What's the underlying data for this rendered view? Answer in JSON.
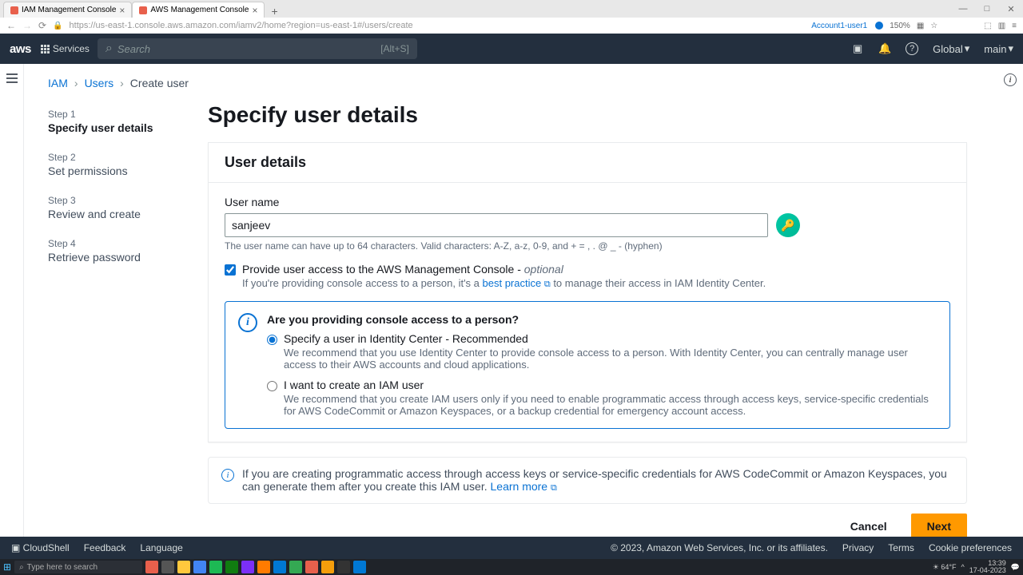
{
  "browser": {
    "tabs": [
      {
        "label": "IAM Management Console",
        "favicon": "#e8604c"
      },
      {
        "label": "AWS Management Console",
        "favicon": "#e8604c"
      }
    ],
    "url": "https://us-east-1.console.aws.amazon.com/iamv2/home?region=us-east-1#/users/create",
    "account_label": "Account1-user1",
    "zoom": "150%"
  },
  "aws_header": {
    "services": "Services",
    "search_placeholder": "Search",
    "search_hint": "[Alt+S]",
    "region": "Global",
    "user": "main"
  },
  "breadcrumb": {
    "root": "IAM",
    "mid": "Users",
    "leaf": "Create user"
  },
  "steps": [
    {
      "num": "Step 1",
      "title": "Specify user details"
    },
    {
      "num": "Step 2",
      "title": "Set permissions"
    },
    {
      "num": "Step 3",
      "title": "Review and create"
    },
    {
      "num": "Step 4",
      "title": "Retrieve password"
    }
  ],
  "page_title": "Specify user details",
  "panel_title": "User details",
  "username": {
    "label": "User name",
    "value": "sanjeev",
    "hint": "The user name can have up to 64 characters. Valid characters: A-Z, a-z, 0-9, and + = , . @ _ - (hyphen)"
  },
  "console_access": {
    "label_pre": "Provide user access to the AWS Management Console - ",
    "label_opt": "optional",
    "sub_pre": "If you're providing console access to a person, it's a ",
    "sub_link": "best practice",
    "sub_post": " to manage their access in IAM Identity Center."
  },
  "person_box": {
    "question": "Are you providing console access to a person?",
    "opt1_label": "Specify a user in Identity Center - Recommended",
    "opt1_sub": "We recommend that you use Identity Center to provide console access to a person. With Identity Center, you can centrally manage user access to their AWS accounts and cloud applications.",
    "opt2_label": "I want to create an IAM user",
    "opt2_sub": "We recommend that you create IAM users only if you need to enable programmatic access through access keys, service-specific credentials for AWS CodeCommit or Amazon Keyspaces, or a backup credential for emergency account access."
  },
  "note": {
    "text": "If you are creating programmatic access through access keys or service-specific credentials for AWS CodeCommit or Amazon Keyspaces, you can generate them after you create this IAM user. ",
    "link": "Learn more"
  },
  "buttons": {
    "cancel": "Cancel",
    "next": "Next"
  },
  "footer": {
    "cloudshell": "CloudShell",
    "feedback": "Feedback",
    "language": "Language",
    "copyright": "© 2023, Amazon Web Services, Inc. or its affiliates.",
    "privacy": "Privacy",
    "terms": "Terms",
    "cookies": "Cookie preferences"
  },
  "taskbar": {
    "search": "Type here to search",
    "weather": "64°F",
    "time": "13:39",
    "date": "17-04-2023"
  }
}
